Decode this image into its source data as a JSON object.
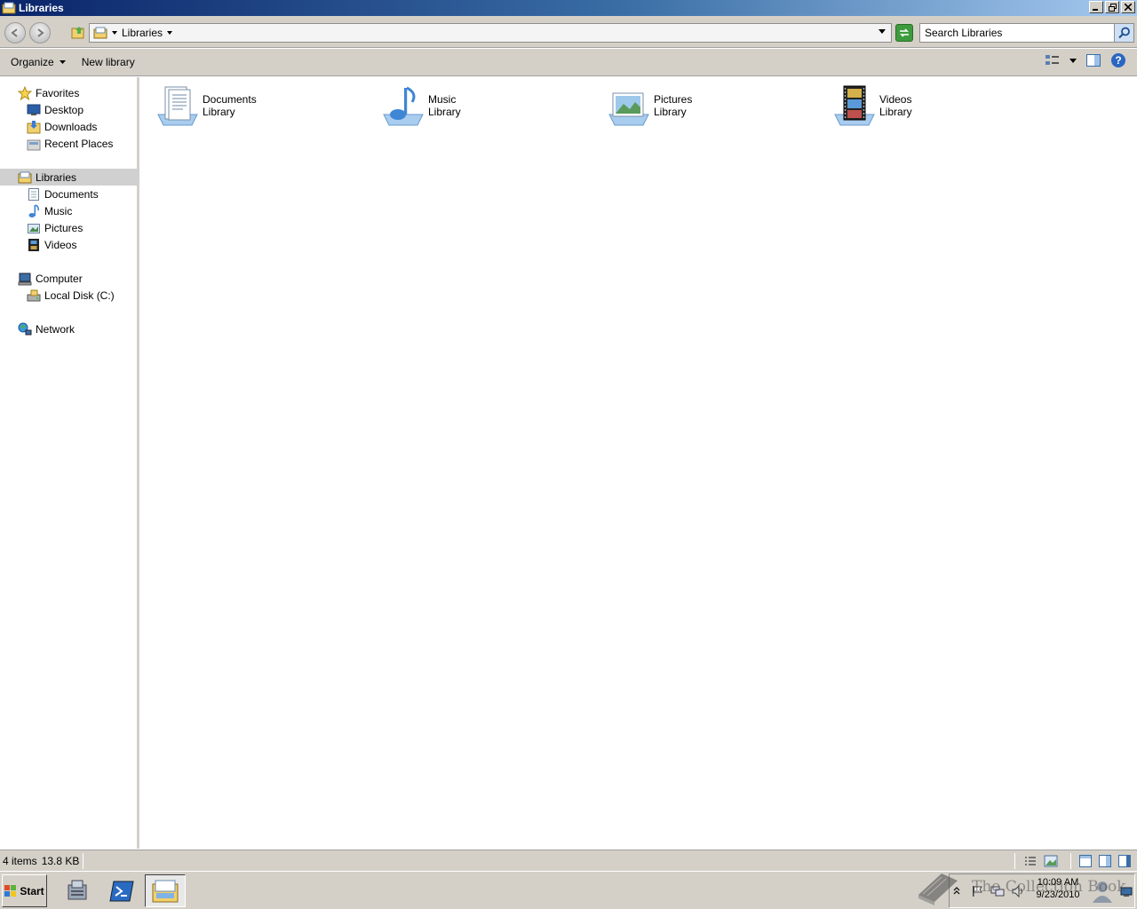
{
  "window": {
    "title": "Libraries"
  },
  "address": {
    "crumb": "Libraries",
    "search_placeholder": "Search Libraries"
  },
  "toolbar": {
    "organize": "Organize",
    "new_library": "New library"
  },
  "nav": {
    "favorites": "Favorites",
    "desktop": "Desktop",
    "downloads": "Downloads",
    "recent": "Recent Places",
    "libraries": "Libraries",
    "lib_documents": "Documents",
    "lib_music": "Music",
    "lib_pictures": "Pictures",
    "lib_videos": "Videos",
    "computer": "Computer",
    "local_disk": "Local Disk (C:)",
    "network": "Network"
  },
  "libraries": [
    {
      "name": "Documents",
      "type": "Library"
    },
    {
      "name": "Music",
      "type": "Library"
    },
    {
      "name": "Pictures",
      "type": "Library"
    },
    {
      "name": "Videos",
      "type": "Library"
    }
  ],
  "status": {
    "count": "4 items",
    "size": "13.8 KB"
  },
  "taskbar": {
    "start": "Start",
    "time": "10:09 AM",
    "date": "9/23/2010"
  },
  "watermark": "The Collection Book"
}
